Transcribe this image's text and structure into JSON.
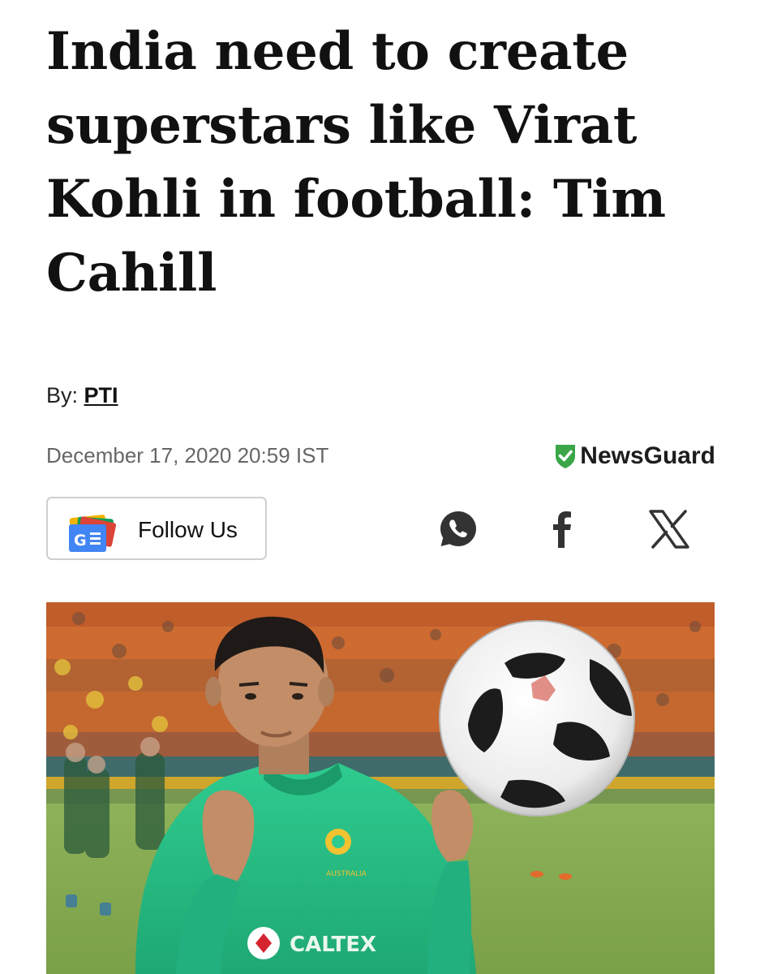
{
  "article": {
    "headline": "India need to create superstars like Virat Kohli in football: Tim Cahill",
    "byline_prefix": "By: ",
    "author": "PTI",
    "date": "December 17, 2020 20:59 IST"
  },
  "newsguard": {
    "label": "NewsGuard",
    "shield_color": "#3aa648"
  },
  "follow": {
    "label": "Follow Us",
    "icon": "google-news-icon"
  },
  "share": {
    "icons": [
      "whatsapp-icon",
      "facebook-icon",
      "x-icon"
    ],
    "icon_color": "#333333"
  },
  "hero_image": {
    "jersey_text": "CALTEX",
    "badge_text": "AUSTRALIA"
  }
}
